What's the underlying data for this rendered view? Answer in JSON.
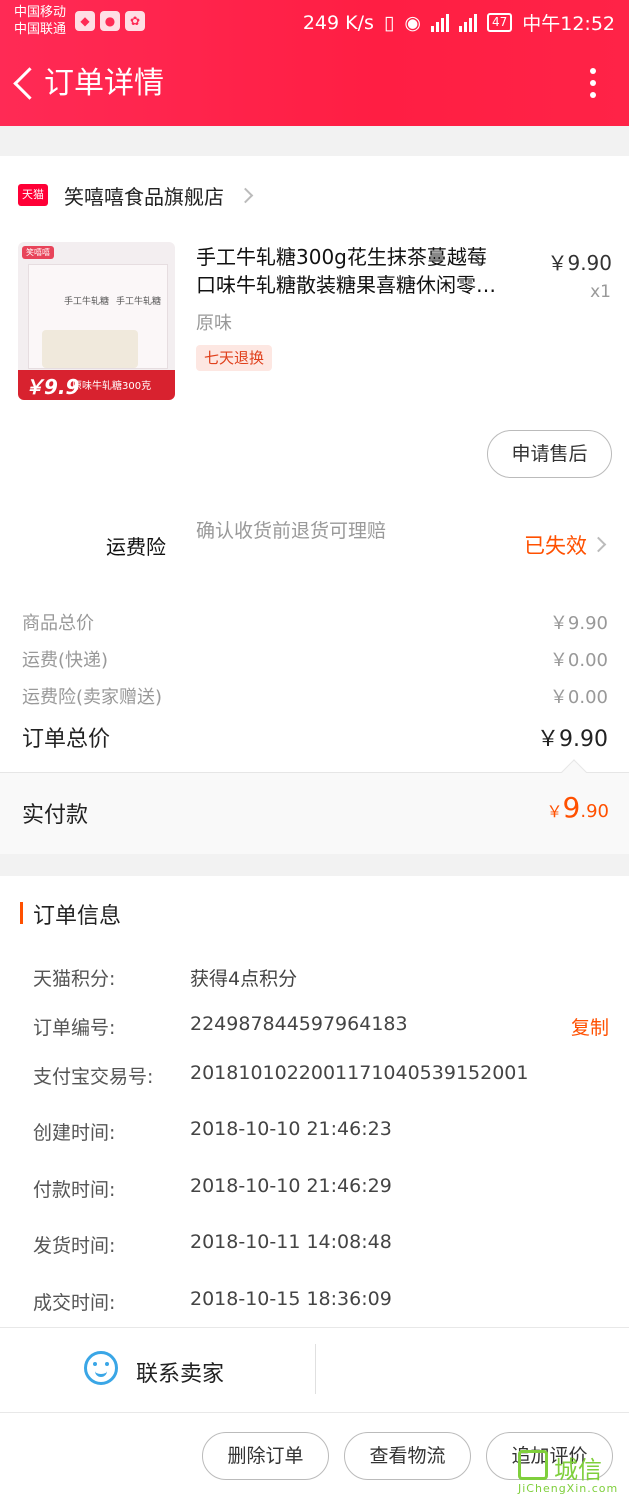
{
  "status_bar": {
    "carrier1": "中国移动",
    "carrier2": "中国联通",
    "speed": "249 K/s",
    "network1": "2G",
    "network2": "4G",
    "battery": "47",
    "time": "中午12:52"
  },
  "nav": {
    "title": "订单详情"
  },
  "shop": {
    "logo_text": "天猫",
    "name": "笑嘻嘻食品旗舰店"
  },
  "product": {
    "title_line1": "手工牛轧糖300g花生抹茶蔓越莓",
    "title_line2": "口味牛轧糖散装糖果喜糖休闲零…",
    "price": "￥9.90",
    "qty": "x1",
    "variant": "原味",
    "badge": "七天退换",
    "image": {
      "brand": "笑嘻嘻",
      "pack_label": "手工牛轧糖",
      "badge_price": "￥9.9",
      "badge_text": "原味牛轧糖300克"
    }
  },
  "after_sale_button": "申请售后",
  "insurance": {
    "label": "运费险",
    "desc": "确认收货前退货可理赔",
    "status": "已失效"
  },
  "fees": [
    {
      "label": "商品总价",
      "value": "￥9.90"
    },
    {
      "label": "运费(快递)",
      "value": "￥0.00"
    },
    {
      "label": "运费险(卖家赠送)",
      "value": "￥0.00"
    }
  ],
  "total": {
    "label": "订单总价",
    "value": "￥9.90"
  },
  "paid": {
    "label": "实付款",
    "currency": "￥",
    "integer": "9",
    "decimal": ".90"
  },
  "order_info": {
    "title": "订单信息",
    "rows": [
      {
        "key": "天猫积分:",
        "value": "获得4点积分"
      },
      {
        "key": "订单编号:",
        "value": "224987844597964183",
        "action": "复制"
      },
      {
        "key": "支付宝交易号:",
        "value": "2018101022001171040539152001"
      },
      {
        "key": "创建时间:",
        "value": "2018-10-10 21:46:23"
      },
      {
        "key": "付款时间:",
        "value": "2018-10-10 21:46:29"
      },
      {
        "key": "发货时间:",
        "value": "2018-10-11 14:08:48"
      },
      {
        "key": "成交时间:",
        "value": "2018-10-15 18:36:09"
      }
    ]
  },
  "contact": {
    "label": "联系卖家"
  },
  "actions": {
    "delete": "删除订单",
    "logistics": "查看物流",
    "review": "追加评价"
  },
  "watermark": {
    "text": "城信",
    "url": "JiChengXin.com"
  }
}
